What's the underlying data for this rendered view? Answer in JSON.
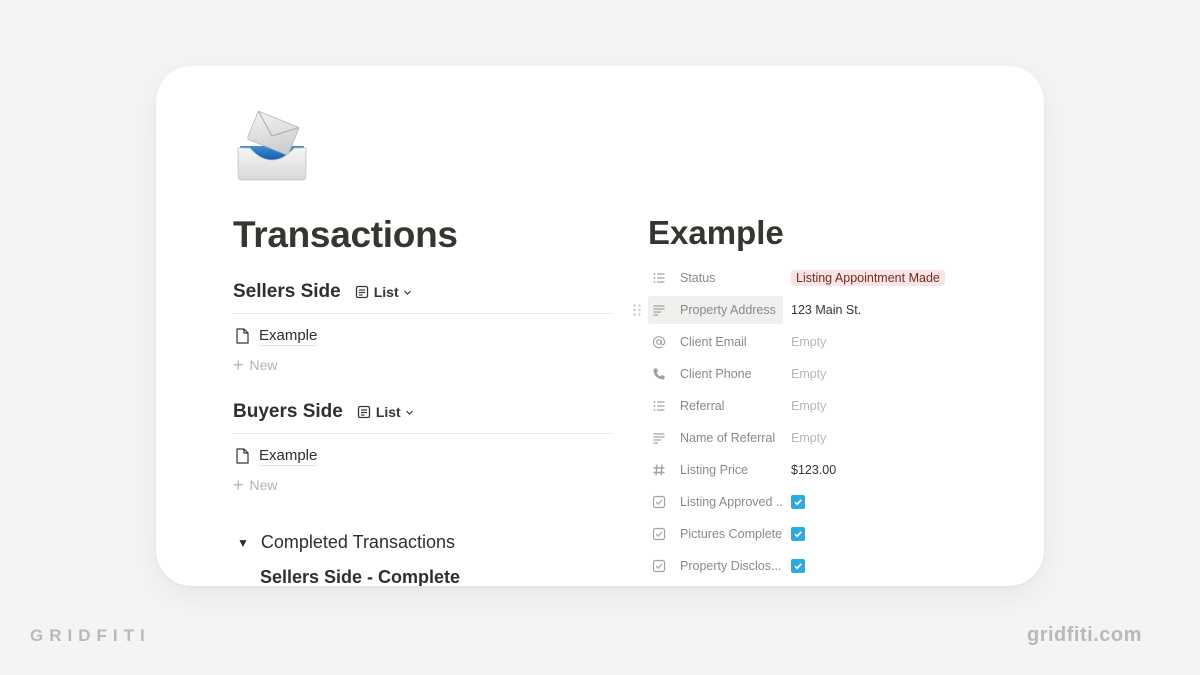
{
  "page": {
    "icon": "incoming-envelope-tray-icon",
    "title": "Transactions"
  },
  "databases": [
    {
      "title": "Sellers Side",
      "view_label": "List",
      "items": [
        {
          "label": "Example",
          "icon": "page-icon"
        }
      ],
      "new_label": "New"
    },
    {
      "title": "Buyers Side",
      "view_label": "List",
      "items": [
        {
          "label": "Example",
          "icon": "page-icon"
        }
      ],
      "new_label": "New"
    }
  ],
  "toggle": {
    "label": "Completed Transactions",
    "expanded": true,
    "child_heading": "Sellers Side - Complete"
  },
  "record": {
    "title": "Example",
    "properties": [
      {
        "icon": "list-icon",
        "name": "Status",
        "type": "select",
        "value": "Listing Appointment Made",
        "tag_bg": "#fbe4e4",
        "tag_color": "#6e2c24"
      },
      {
        "icon": "text-icon",
        "name": "Property Address",
        "type": "text",
        "value": "123 Main St.",
        "hovered": true
      },
      {
        "icon": "at-icon",
        "name": "Client Email",
        "type": "empty",
        "value": "Empty"
      },
      {
        "icon": "phone-icon",
        "name": "Client Phone",
        "type": "empty",
        "value": "Empty"
      },
      {
        "icon": "list-icon",
        "name": "Referral",
        "type": "empty",
        "value": "Empty"
      },
      {
        "icon": "text-icon",
        "name": "Name of Referral",
        "type": "empty",
        "value": "Empty"
      },
      {
        "icon": "hash-icon",
        "name": "Listing Price",
        "type": "number",
        "value": "$123.00"
      },
      {
        "icon": "checkbox-icon",
        "name": "Listing Approved ...",
        "type": "checkbox",
        "checked": true
      },
      {
        "icon": "checkbox-icon",
        "name": "Pictures Complete",
        "type": "checkbox",
        "checked": true
      },
      {
        "icon": "checkbox-icon",
        "name": "Property Disclos...",
        "type": "checkbox",
        "checked": true
      }
    ]
  },
  "branding": {
    "left": "GRIDFITI",
    "right": "gridfiti.com"
  },
  "colors": {
    "background": "#f4f4f4",
    "card": "#ffffff",
    "checkbox_accent": "#2eaadc",
    "brand_gray": "#b9b9b9"
  }
}
